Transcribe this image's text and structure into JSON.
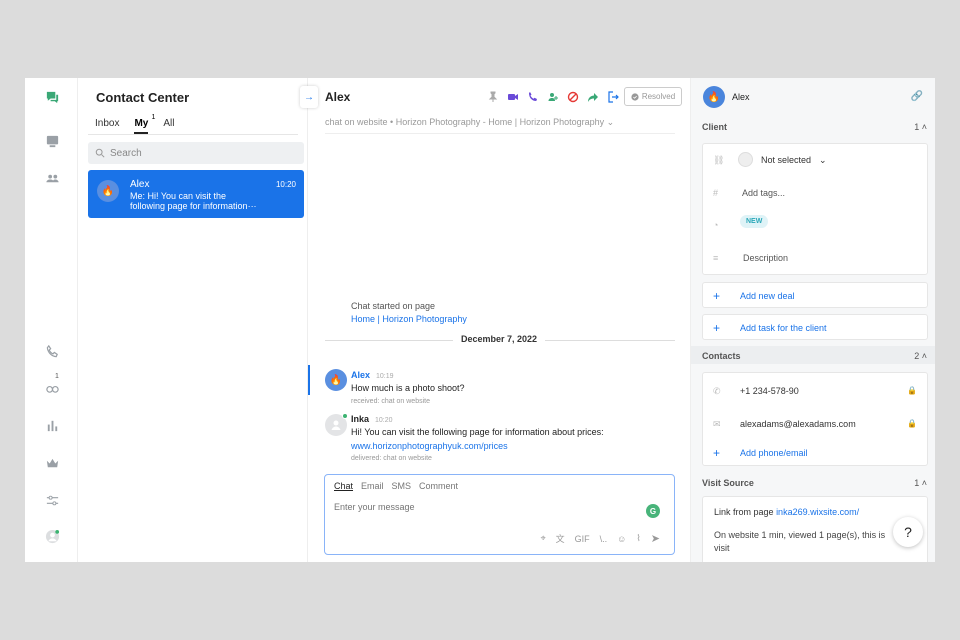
{
  "rail": {
    "icons": [
      "chat-bubbles-icon",
      "monitor-icon",
      "people-icon",
      "phone-icon",
      "dog-icon",
      "bar-chart-icon",
      "crown-icon",
      "sliders-icon",
      "user-avatar-icon"
    ],
    "dog_badge": "1"
  },
  "list": {
    "title": "Contact Center",
    "tabs": [
      "Inbox",
      "My",
      "All"
    ],
    "my_badge": "1",
    "search_placeholder": "Search",
    "conversations": [
      {
        "name": "Alex",
        "time": "10:20",
        "preview": "Me: Hi! You can visit the following page for information···"
      }
    ]
  },
  "chat": {
    "title": "Alex",
    "resolved": "Resolved",
    "subtitle": "chat on website • Horizon Photography - Home | Horizon Photography",
    "started": "Chat started on page",
    "started_link": "Home | Horizon Photography",
    "date": "December 7, 2022",
    "messages": [
      {
        "name": "Alex",
        "time": "10:19",
        "text": "How much is a photo shoot?",
        "meta": "received: chat on website"
      },
      {
        "name": "Inka",
        "time": "10:20",
        "text": "Hi! You can visit the following page for information about prices:",
        "link": "www.horizonphotographyuk.com/prices",
        "meta": "delivered: chat on website"
      }
    ],
    "composer": {
      "tabs": [
        "Chat",
        "Email",
        "SMS",
        "Comment"
      ],
      "placeholder": "Enter your message",
      "gif": "GIF",
      "slash": "\\.."
    }
  },
  "right": {
    "name": "Alex",
    "client": {
      "label": "Client",
      "count": "1",
      "assignee": "Not selected",
      "tags": "Add tags...",
      "status": "NEW",
      "description": "Description"
    },
    "add_deal": "Add new deal",
    "add_task": "Add task for the client",
    "contacts": {
      "label": "Contacts",
      "count": "2",
      "phone": "+1 234-578-90",
      "email": "alexadams@alexadams.com",
      "add": "Add phone/email"
    },
    "visit": {
      "label": "Visit Source",
      "count": "1",
      "link_prefix": "Link from page",
      "link": "inka269.wixsite.com/",
      "info": "On website 1 min, viewed 1 page(s), this is",
      "info2": "visit"
    },
    "help": "?"
  },
  "colors": {
    "accent": "#1a73e8",
    "online": "#3cb371"
  }
}
